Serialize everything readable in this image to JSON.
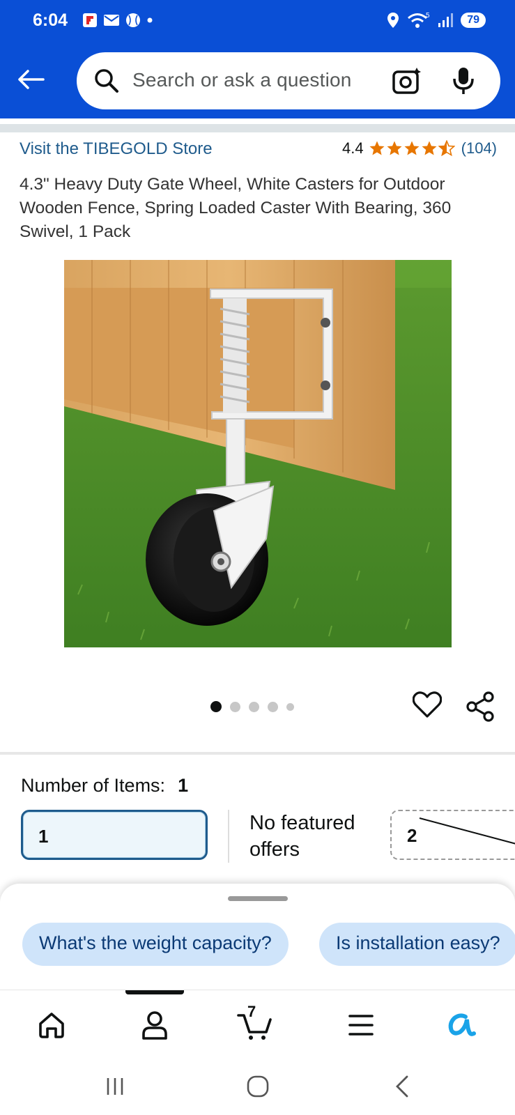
{
  "status_bar": {
    "time": "6:04",
    "battery": "79",
    "notification_icons": [
      "flipboard-icon",
      "mail-icon",
      "baseball-icon",
      "dot-icon"
    ],
    "system_icons": [
      "location-icon",
      "wifi-icon",
      "signal-icon",
      "battery-icon"
    ]
  },
  "header": {
    "search_placeholder": "Search or ask a question",
    "background_color": "#0A4FD6"
  },
  "store": {
    "link_text": "Visit the TIBEGOLD Store",
    "rating_value": "4.4",
    "rating_count": "(104)",
    "stars": 4.4,
    "star_color": "#E77600"
  },
  "product": {
    "title": "4.3\" Heavy Duty Gate Wheel, White Casters for Outdoor Wooden Fence, Spring Loaded Caster With Bearing, 360 Swivel, 1 Pack",
    "image_icon": "gate-wheel-product-image",
    "image_count": 5,
    "image_index": 1
  },
  "variation": {
    "label": "Number of Items:",
    "selected_value": "1",
    "option_selected": "1",
    "option_note": "No featured offers",
    "option_unavailable": "2"
  },
  "rufus": {
    "chips": [
      "What's the weight capacity?",
      "Is installation easy?"
    ]
  },
  "bottom_nav": {
    "items": [
      "home-icon",
      "account-icon",
      "cart-icon",
      "menu-icon",
      "rufus-icon"
    ],
    "cart_count": "7",
    "accent_color": "#1AA3E8"
  }
}
